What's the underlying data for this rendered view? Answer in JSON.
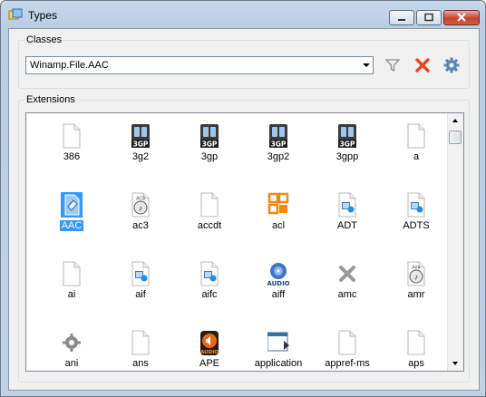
{
  "window": {
    "title": "Types"
  },
  "classes": {
    "legend": "Classes",
    "selected": "Winamp.File.AAC"
  },
  "toolbar": {
    "filter_icon": "filter-icon",
    "delete_icon": "delete-x-icon",
    "settings_icon": "gear-icon"
  },
  "extensions": {
    "legend": "Extensions",
    "items": [
      {
        "label": "386",
        "icon": "blank-file-icon"
      },
      {
        "label": "3g2",
        "icon": "3gp-file-icon"
      },
      {
        "label": "3gp",
        "icon": "3gp-file-icon"
      },
      {
        "label": "3gp2",
        "icon": "3gp-file-icon"
      },
      {
        "label": "3gpp",
        "icon": "3gp-file-icon"
      },
      {
        "label": "a",
        "icon": "blank-file-icon"
      },
      {
        "label": "AAC",
        "icon": "winamp-file-icon",
        "selected": true
      },
      {
        "label": "ac3",
        "icon": "ac3-audio-file-icon"
      },
      {
        "label": "accdt",
        "icon": "blank-file-icon"
      },
      {
        "label": "acl",
        "icon": "office-file-icon"
      },
      {
        "label": "ADT",
        "icon": "media-file-icon"
      },
      {
        "label": "ADTS",
        "icon": "media-file-icon"
      },
      {
        "label": "ai",
        "icon": "blank-file-icon"
      },
      {
        "label": "aif",
        "icon": "media-file-icon"
      },
      {
        "label": "aifc",
        "icon": "media-file-icon"
      },
      {
        "label": "aiff",
        "icon": "audio-file-icon"
      },
      {
        "label": "amc",
        "icon": "gray-x-icon"
      },
      {
        "label": "amr",
        "icon": "amr-audio-file-icon"
      },
      {
        "label": "ani",
        "icon": "gear-file-icon"
      },
      {
        "label": "ans",
        "icon": "blank-file-icon"
      },
      {
        "label": "APE",
        "icon": "ape-audio-file-icon"
      },
      {
        "label": "application",
        "icon": "application-file-icon"
      },
      {
        "label": "appref-ms",
        "icon": "blank-file-icon"
      },
      {
        "label": "aps",
        "icon": "blank-file-icon"
      }
    ]
  }
}
